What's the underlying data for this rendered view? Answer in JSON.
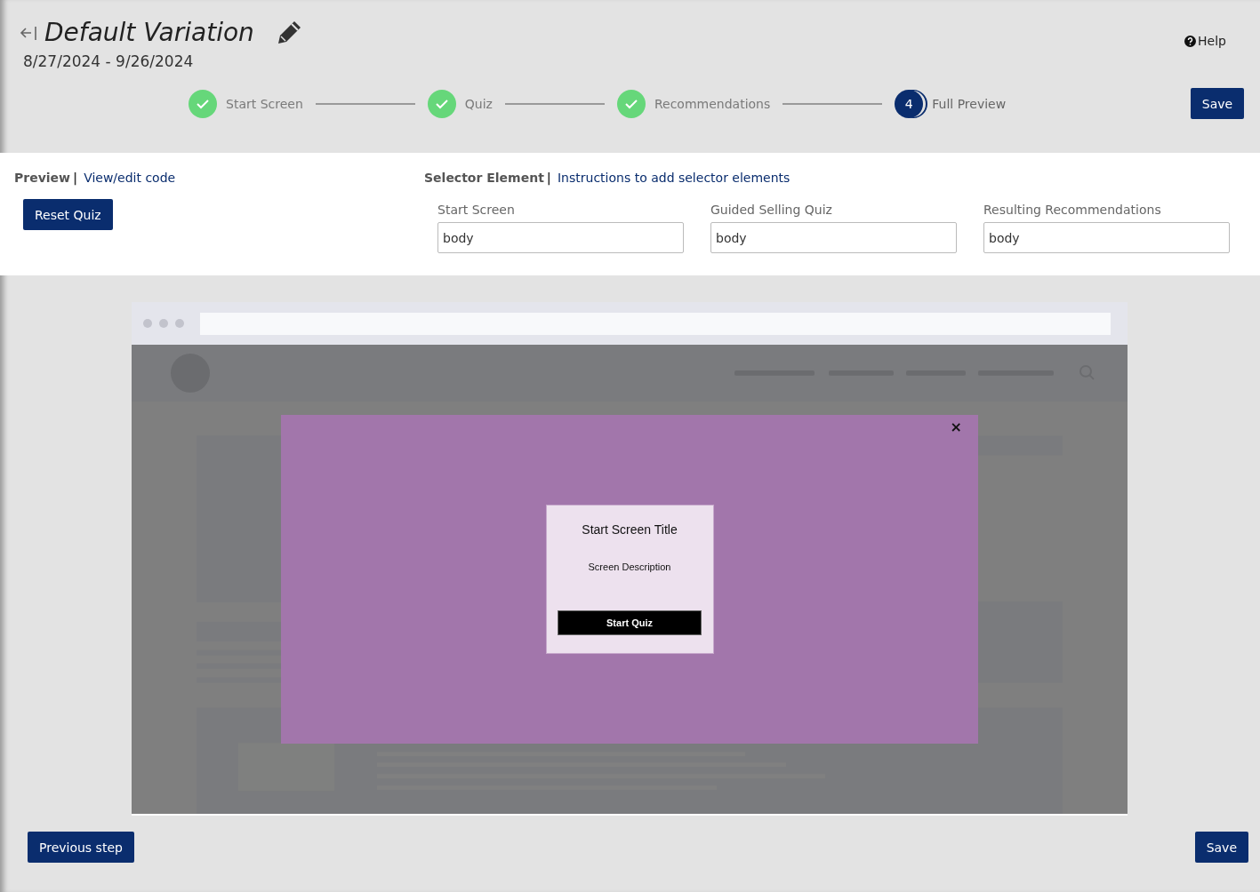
{
  "header": {
    "title": "Default Variation",
    "date_range": "8/27/2024 - 9/26/2024",
    "help": "Help"
  },
  "steps": [
    {
      "label": "Start Screen",
      "completed": true,
      "selected": false
    },
    {
      "label": "Quiz",
      "completed": true,
      "selected": false
    },
    {
      "label": "Recommendations",
      "completed": true,
      "selected": false
    },
    {
      "label": "Full Preview",
      "completed": false,
      "selected": true,
      "number": "4"
    }
  ],
  "save_top": "Save",
  "preview_panel": {
    "separator": "|",
    "tabs": [
      {
        "label": "Preview",
        "selected": true
      },
      {
        "label": "View/edit code",
        "selected": false
      }
    ],
    "reset_button": "Reset Quiz"
  },
  "selector_panel": {
    "title": "Selector Element",
    "separator": "|",
    "link": "Instructions to add selector elements",
    "fields": [
      {
        "label": "Start Screen",
        "value": "body"
      },
      {
        "label": "Guided Selling Quiz",
        "value": "body"
      },
      {
        "label": "Resulting Recommendations",
        "value": "body"
      }
    ]
  },
  "preview": {
    "close": "×",
    "card_title": "Start Screen Title",
    "card_description": "Screen Description",
    "card_button": "Start Quiz"
  },
  "footer": {
    "previous": "Previous step",
    "save": "Save"
  }
}
